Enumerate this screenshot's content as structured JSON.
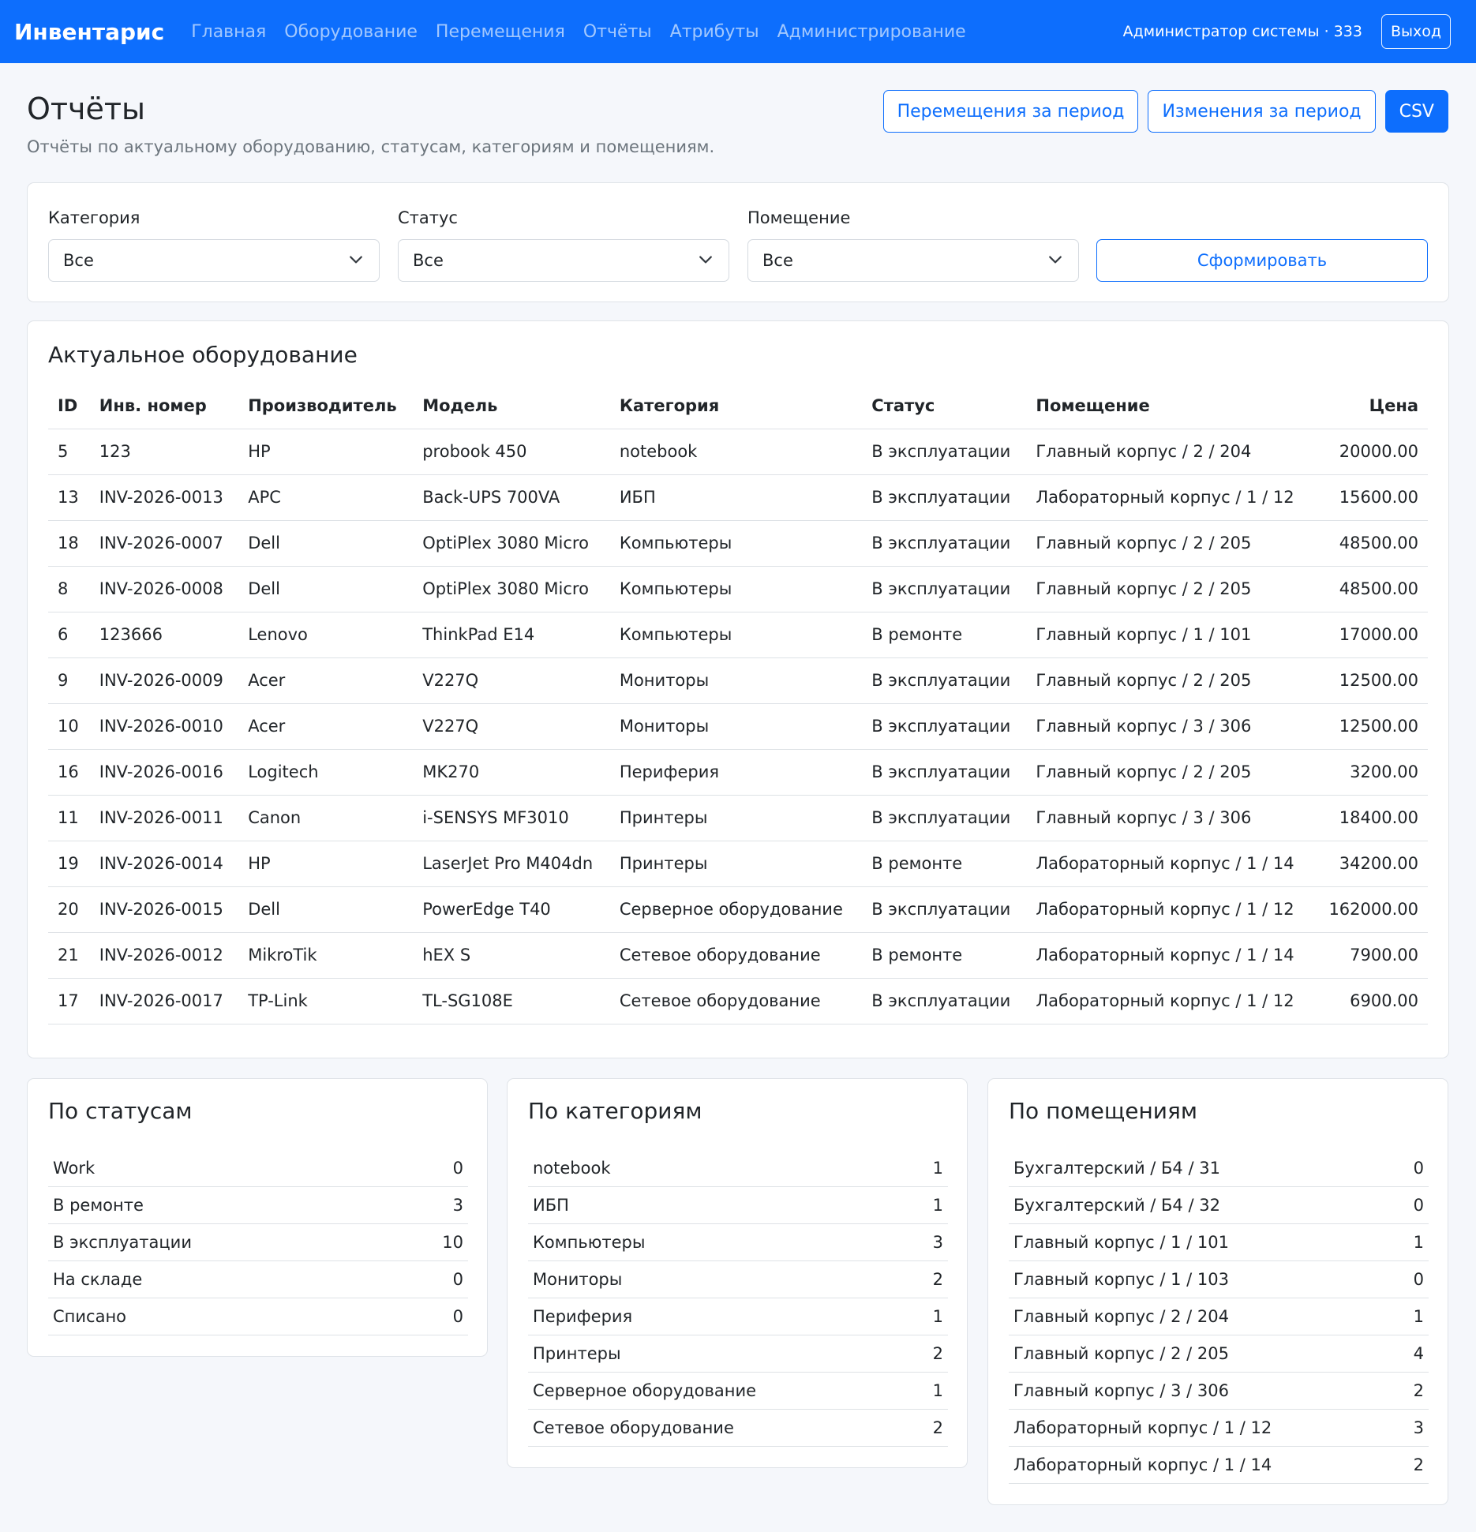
{
  "navbar": {
    "brand": "Инвентарис",
    "links": [
      "Главная",
      "Оборудование",
      "Перемещения",
      "Отчёты",
      "Атрибуты",
      "Администрирование"
    ],
    "user": "Администратор системы · 333",
    "logout": "Выход"
  },
  "header": {
    "title": "Отчёты",
    "subtitle": "Отчёты по актуальному оборудованию, статусам, категориям и помещениям.",
    "actions": [
      "Перемещения за период",
      "Изменения за период",
      "CSV"
    ]
  },
  "filters": {
    "category_label": "Категория",
    "category_value": "Все",
    "status_label": "Статус",
    "status_value": "Все",
    "room_label": "Помещение",
    "room_value": "Все",
    "submit": "Сформировать"
  },
  "equipment": {
    "title": "Актуальное оборудование",
    "columns": [
      "ID",
      "Инв. номер",
      "Производитель",
      "Модель",
      "Категория",
      "Статус",
      "Помещение",
      "Цена"
    ],
    "rows": [
      [
        "5",
        "123",
        "HP",
        "probook 450",
        "notebook",
        "В эксплуатации",
        "Главный корпус / 2 / 204",
        "20000.00"
      ],
      [
        "13",
        "INV-2026-0013",
        "APC",
        "Back-UPS 700VA",
        "ИБП",
        "В эксплуатации",
        "Лабораторный корпус / 1 / 12",
        "15600.00"
      ],
      [
        "18",
        "INV-2026-0007",
        "Dell",
        "OptiPlex 3080 Micro",
        "Компьютеры",
        "В эксплуатации",
        "Главный корпус / 2 / 205",
        "48500.00"
      ],
      [
        "8",
        "INV-2026-0008",
        "Dell",
        "OptiPlex 3080 Micro",
        "Компьютеры",
        "В эксплуатации",
        "Главный корпус / 2 / 205",
        "48500.00"
      ],
      [
        "6",
        "123666",
        "Lenovo",
        "ThinkPad E14",
        "Компьютеры",
        "В ремонте",
        "Главный корпус / 1 / 101",
        "17000.00"
      ],
      [
        "9",
        "INV-2026-0009",
        "Acer",
        "V227Q",
        "Мониторы",
        "В эксплуатации",
        "Главный корпус / 2 / 205",
        "12500.00"
      ],
      [
        "10",
        "INV-2026-0010",
        "Acer",
        "V227Q",
        "Мониторы",
        "В эксплуатации",
        "Главный корпус / 3 / 306",
        "12500.00"
      ],
      [
        "16",
        "INV-2026-0016",
        "Logitech",
        "MK270",
        "Периферия",
        "В эксплуатации",
        "Главный корпус / 2 / 205",
        "3200.00"
      ],
      [
        "11",
        "INV-2026-0011",
        "Canon",
        "i-SENSYS MF3010",
        "Принтеры",
        "В эксплуатации",
        "Главный корпус / 3 / 306",
        "18400.00"
      ],
      [
        "19",
        "INV-2026-0014",
        "HP",
        "LaserJet Pro M404dn",
        "Принтеры",
        "В ремонте",
        "Лабораторный корпус / 1 / 14",
        "34200.00"
      ],
      [
        "20",
        "INV-2026-0015",
        "Dell",
        "PowerEdge T40",
        "Серверное оборудование",
        "В эксплуатации",
        "Лабораторный корпус / 1 / 12",
        "162000.00"
      ],
      [
        "21",
        "INV-2026-0012",
        "MikroTik",
        "hEX S",
        "Сетевое оборудование",
        "В ремонте",
        "Лабораторный корпус / 1 / 14",
        "7900.00"
      ],
      [
        "17",
        "INV-2026-0017",
        "TP-Link",
        "TL-SG108E",
        "Сетевое оборудование",
        "В эксплуатации",
        "Лабораторный корпус / 1 / 12",
        "6900.00"
      ]
    ]
  },
  "by_status": {
    "title": "По статусам",
    "rows": [
      [
        "Work",
        "0"
      ],
      [
        "В ремонте",
        "3"
      ],
      [
        "В эксплуатации",
        "10"
      ],
      [
        "На складе",
        "0"
      ],
      [
        "Списано",
        "0"
      ]
    ]
  },
  "by_category": {
    "title": "По категориям",
    "rows": [
      [
        "notebook",
        "1"
      ],
      [
        "ИБП",
        "1"
      ],
      [
        "Компьютеры",
        "3"
      ],
      [
        "Мониторы",
        "2"
      ],
      [
        "Периферия",
        "1"
      ],
      [
        "Принтеры",
        "2"
      ],
      [
        "Серверное оборудование",
        "1"
      ],
      [
        "Сетевое оборудование",
        "2"
      ]
    ]
  },
  "by_room": {
    "title": "По помещениям",
    "rows": [
      [
        "Бухгалтерский / Б4 / 31",
        "0"
      ],
      [
        "Бухгалтерский / Б4 / 32",
        "0"
      ],
      [
        "Главный корпус / 1 / 101",
        "1"
      ],
      [
        "Главный корпус / 1 / 103",
        "0"
      ],
      [
        "Главный корпус / 2 / 204",
        "1"
      ],
      [
        "Главный корпус / 2 / 205",
        "4"
      ],
      [
        "Главный корпус / 3 / 306",
        "2"
      ],
      [
        "Лабораторный корпус / 1 / 12",
        "3"
      ],
      [
        "Лабораторный корпус / 1 / 14",
        "2"
      ]
    ]
  }
}
